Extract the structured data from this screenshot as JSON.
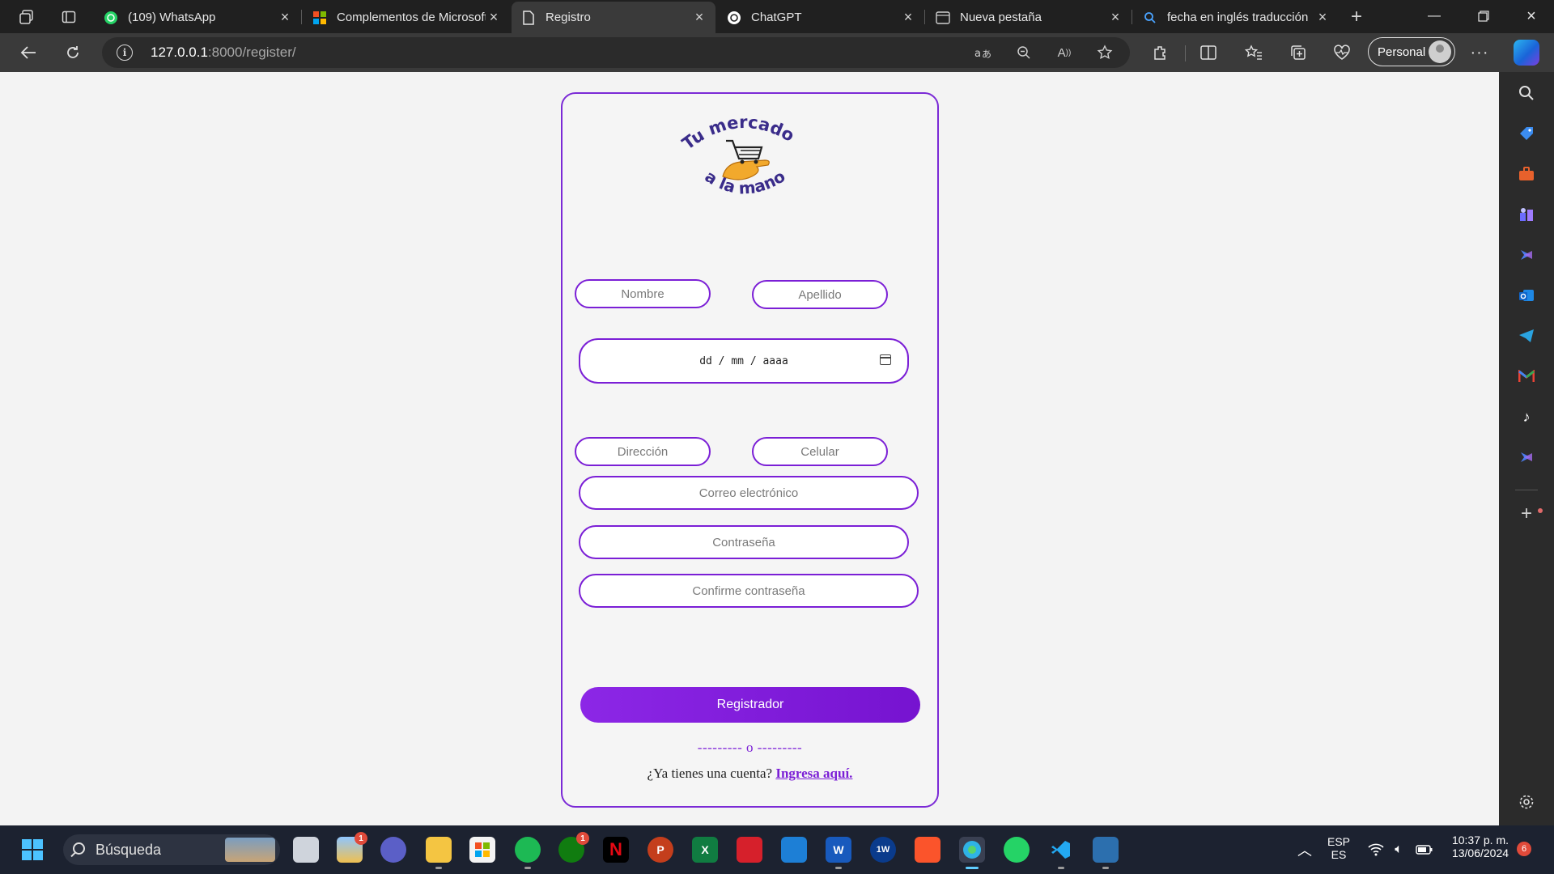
{
  "browser": {
    "tabs": [
      {
        "title": "(109) WhatsApp",
        "icon": "whatsapp-icon",
        "active": false
      },
      {
        "title": "Complementos de Microsoft",
        "icon": "microsoft-icon",
        "active": false
      },
      {
        "title": "Registro",
        "icon": "page-icon",
        "active": true
      },
      {
        "title": "ChatGPT",
        "icon": "chatgpt-icon",
        "active": false
      },
      {
        "title": "Nueva pestaña",
        "icon": "newtab-icon",
        "active": false
      },
      {
        "title": "fecha en inglés traducción",
        "icon": "search-icon",
        "active": false
      }
    ],
    "url_host": "127.0.0.1",
    "url_rest": ":8000/register/",
    "profile_label": "Personal"
  },
  "logo": {
    "line1": "Tu mercado",
    "line2": "a la mano"
  },
  "form": {
    "nombre_placeholder": "Nombre",
    "apellido_placeholder": "Apellido",
    "date_placeholder": "dd / mm / aaaa",
    "direccion_placeholder": "Dirección",
    "celular_placeholder": "Celular",
    "email_placeholder": "Correo electrónico",
    "password_placeholder": "Contraseña",
    "confirm_placeholder": "Confirme contraseña",
    "submit_label": "Registrador",
    "divider": "--------- o ---------",
    "login_prompt": "¿Ya tienes una cuenta?",
    "login_link": "Ingresa aquí."
  },
  "taskbar": {
    "search_label": "Búsqueda",
    "weather_badge": "1",
    "xbox_badge": "1",
    "lang_top": "ESP",
    "lang_bottom": "ES",
    "time": "10:37 p. m.",
    "date": "13/06/2024",
    "notifications": "6"
  },
  "colors": {
    "accent": "#7b1fd6",
    "logo_text": "#3a2c8a",
    "page_bg": "#f3f3f3"
  }
}
